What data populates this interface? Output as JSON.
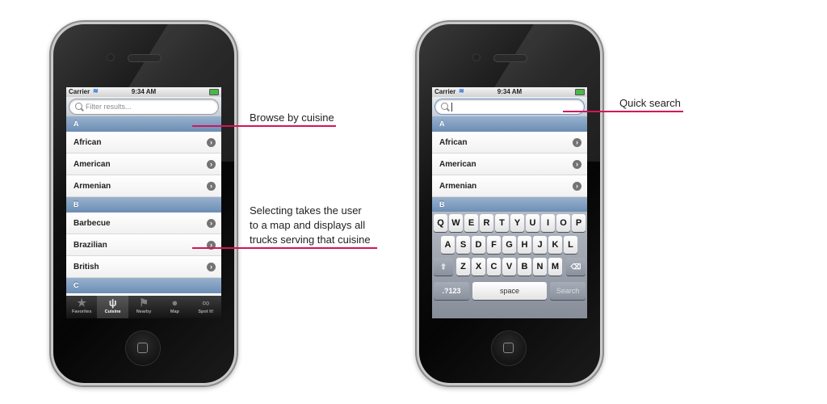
{
  "status": {
    "carrier": "Carrier",
    "time": "9:34 AM"
  },
  "left_screen": {
    "search_placeholder": "Filter results...",
    "sections": [
      "A",
      "B",
      "C"
    ],
    "items_a": [
      "African",
      "American",
      "Armenian"
    ],
    "items_b": [
      "Barbecue",
      "Brazilian",
      "British"
    ],
    "tabs": [
      "Favorites",
      "Cuisine",
      "Nearby",
      "Map",
      "Spot It!"
    ],
    "active_tab": "Cuisine"
  },
  "right_screen": {
    "search_placeholder": "",
    "sections": [
      "A",
      "B"
    ],
    "items_a": [
      "African",
      "American",
      "Armenian"
    ],
    "keyboard": {
      "row1": [
        "Q",
        "W",
        "E",
        "R",
        "T",
        "Y",
        "U",
        "I",
        "O",
        "P"
      ],
      "row2": [
        "A",
        "S",
        "D",
        "F",
        "G",
        "H",
        "J",
        "K",
        "L"
      ],
      "row3": [
        "Z",
        "X",
        "C",
        "V",
        "B",
        "N",
        "M"
      ],
      "numbers_key": ".?123",
      "space_key": "space",
      "search_key": "Search"
    }
  },
  "annotations": {
    "browse": "Browse by cuisine",
    "selecting": [
      "Selecting takes the user",
      "to a map and displays all",
      "trucks serving that cuisine"
    ],
    "quick_search": "Quick search"
  },
  "colors": {
    "accent_line": "#d4145a",
    "section_header": "#7a98bd"
  },
  "icons": [
    "search-icon",
    "wifi-icon",
    "battery-icon",
    "disclosure-arrow-icon",
    "star-icon",
    "fork-knife-icon",
    "runner-icon",
    "globe-icon",
    "binoculars-icon",
    "shift-icon",
    "backspace-icon",
    "home-button-icon"
  ]
}
